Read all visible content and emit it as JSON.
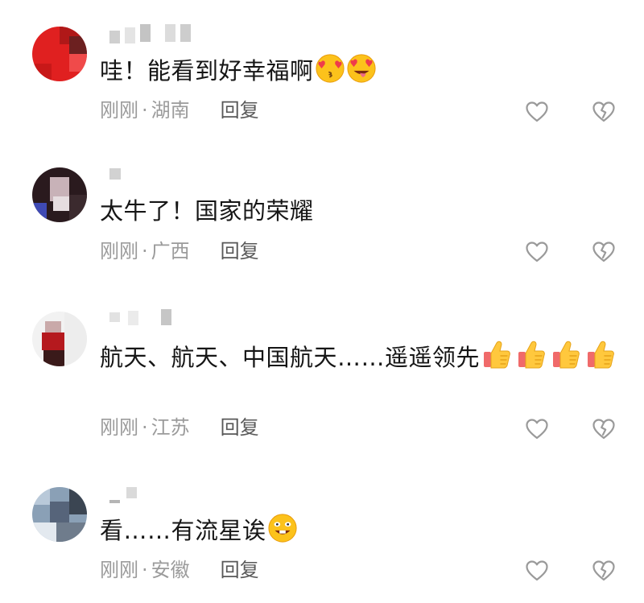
{
  "comments": [
    {
      "text": "哇！能看到好幸福啊",
      "emojis": [
        "heart-eyes-kiss-emoji",
        "heart-eyes-tongue-emoji"
      ],
      "time": "刚刚",
      "sep": "·",
      "location": "湖南",
      "reply": "回复"
    },
    {
      "text": "太牛了！国家的荣耀",
      "emojis": [],
      "time": "刚刚",
      "sep": "·",
      "location": "广西",
      "reply": "回复"
    },
    {
      "text": "航天、航天、中国航天……遥遥领先",
      "emojis": [
        "thumbs-up-emoji",
        "thumbs-up-emoji",
        "thumbs-up-emoji",
        "thumbs-up-emoji"
      ],
      "time": "刚刚",
      "sep": "·",
      "location": "江苏",
      "reply": "回复"
    },
    {
      "text": "看……有流星诶",
      "emojis": [
        "grinning-emoji"
      ],
      "time": "刚刚",
      "sep": "·",
      "location": "安徽",
      "reply": "回复"
    }
  ],
  "icons": {
    "like": "heart-outline-icon",
    "dislike": "broken-heart-outline-icon"
  },
  "colors": {
    "text": "#161616",
    "meta": "#9b9b9b",
    "reply": "#585858",
    "icon": "#9a9a9a"
  }
}
